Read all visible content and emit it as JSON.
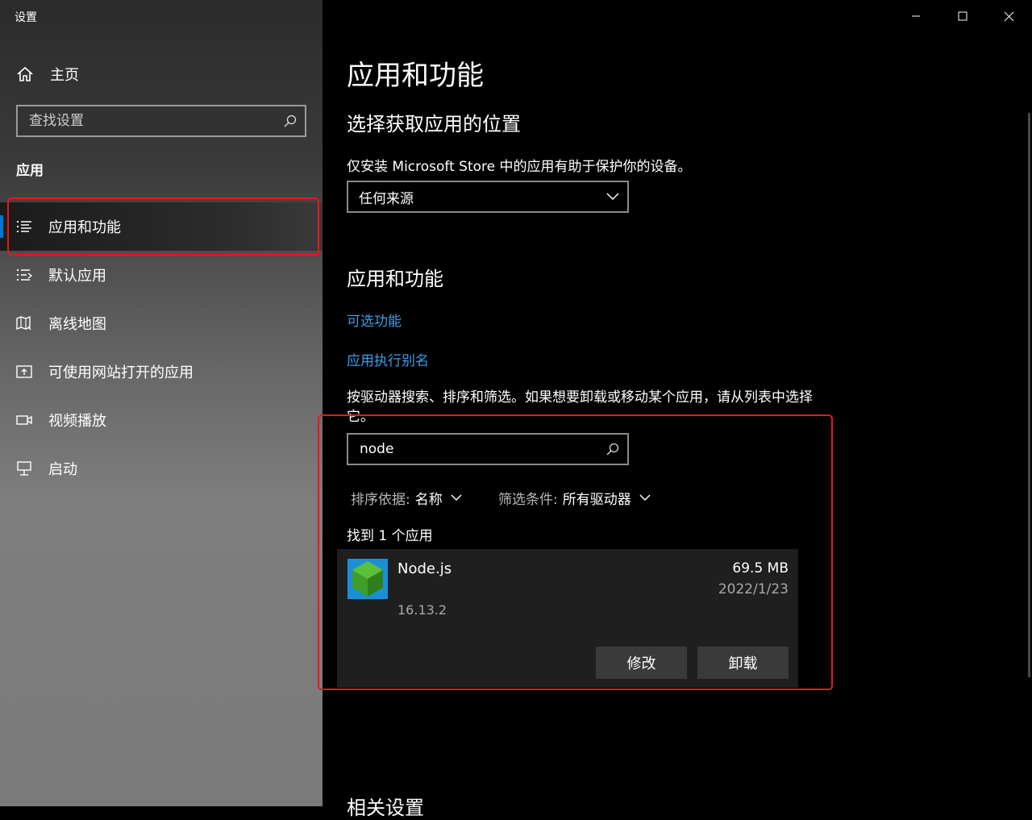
{
  "window": {
    "title": "设置",
    "controls": [
      "minimize-icon",
      "maximize-icon",
      "close-icon"
    ]
  },
  "sidebar": {
    "home_label": "主页",
    "search_placeholder": "查找设置",
    "section_title": "应用",
    "items": [
      {
        "label": "应用和功能",
        "icon": "apps-list-icon",
        "active": true
      },
      {
        "label": "默认应用",
        "icon": "default-apps-icon"
      },
      {
        "label": "离线地图",
        "icon": "map-icon"
      },
      {
        "label": "可使用网站打开的应用",
        "icon": "open-with-site-icon"
      },
      {
        "label": "视频播放",
        "icon": "video-icon"
      },
      {
        "label": "启动",
        "icon": "startup-icon"
      }
    ]
  },
  "main": {
    "page_title": "应用和功能",
    "source_section_title": "选择获取应用的位置",
    "source_hint": "仅安装 Microsoft Store 中的应用有助于保护你的设备。",
    "source_dropdown_value": "任何来源",
    "apps_section_title": "应用和功能",
    "link_optional_features": "可选功能",
    "link_app_aliases": "应用执行别名",
    "search_hint": "按驱动器搜索、排序和筛选。如果想要卸载或移动某个应用，请从列表中选择它。",
    "search_value": "node",
    "sort_label": "排序依据:",
    "sort_value": "名称",
    "filter_label": "筛选条件:",
    "filter_value": "所有驱动器",
    "results_count": "找到 1 个应用",
    "app": {
      "name": "Node.js",
      "version": "16.13.2",
      "size": "69.5 MB",
      "date": "2022/1/23",
      "modify_label": "修改",
      "uninstall_label": "卸载"
    },
    "related_settings_title": "相关设置"
  },
  "colors": {
    "accent": "#0078d7",
    "link": "#3d9ee8",
    "highlight_box": "#e81818"
  }
}
